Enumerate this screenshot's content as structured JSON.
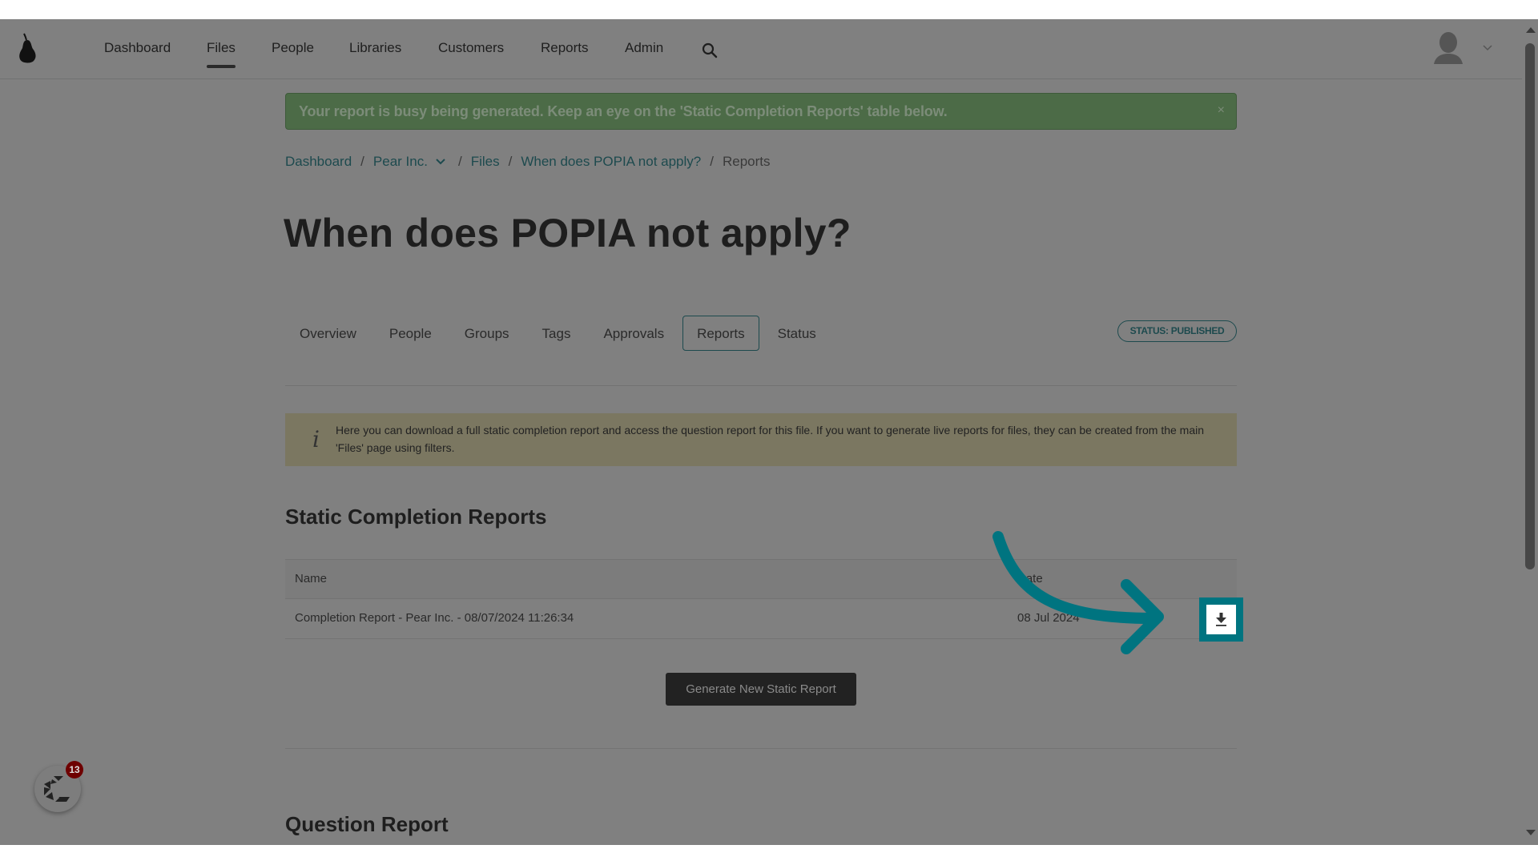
{
  "nav": {
    "items": [
      {
        "label": "Dashboard",
        "active": false
      },
      {
        "label": "Files",
        "active": true
      },
      {
        "label": "People",
        "active": false
      },
      {
        "label": "Libraries",
        "active": false
      },
      {
        "label": "Customers",
        "active": false
      },
      {
        "label": "Reports",
        "active": false
      },
      {
        "label": "Admin",
        "active": false
      }
    ],
    "search_icon": "search-icon",
    "avatar_icon": "user-avatar-icon",
    "menu_icon": "chevron-down-icon"
  },
  "alert": {
    "message": "Your report is busy being generated. Keep an eye on the 'Static Completion Reports' table below.",
    "close_label": "×",
    "color": "#4c6b47"
  },
  "breadcrumb": {
    "items": [
      "Dashboard",
      "Pear Inc.",
      "Files",
      "When does POPIA not apply?"
    ],
    "current": "Reports",
    "separator": "/"
  },
  "page": {
    "title": "When does POPIA not apply?"
  },
  "tabs": {
    "items": [
      "Overview",
      "People",
      "Groups",
      "Tags",
      "Approvals",
      "Reports",
      "Status"
    ],
    "active": "Reports",
    "status_badge": "STATUS: PUBLISHED"
  },
  "info": {
    "icon": "info-icon",
    "text": "Here you can download a full static completion report and access the question report for this file. If you want to generate live reports for files, they can be created from the main 'Files' page using filters."
  },
  "static_reports": {
    "heading": "Static Completion Reports",
    "columns": [
      "Name",
      "Date"
    ],
    "rows": [
      {
        "name": "Completion Report - Pear Inc. - 08/07/2024 11:26:34",
        "date": "08 Jul 2024",
        "action_icon": "download-icon"
      }
    ],
    "generate_button": "Generate New Static Report",
    "highlight_color": "#007480"
  },
  "question_report": {
    "heading": "Question Report"
  },
  "chat_widget": {
    "badge_count": "13"
  }
}
